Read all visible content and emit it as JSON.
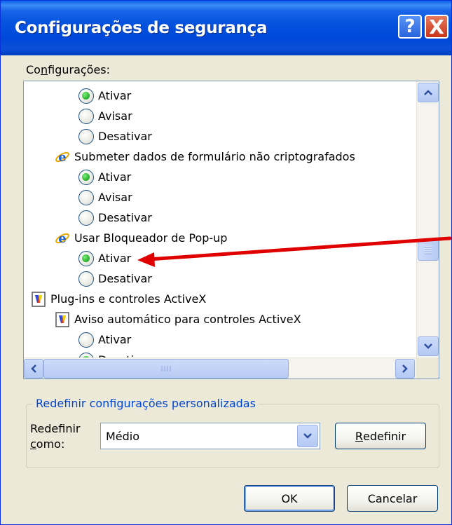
{
  "window": {
    "title": "Configurações de segurança",
    "help_symbol": "?",
    "close_symbol": "X"
  },
  "settings_label_pre": "Co",
  "settings_label_accel": "n",
  "settings_label_post": "figurações:",
  "settings_list": [
    {
      "kind": "radio",
      "label": "Ativar",
      "selected": true
    },
    {
      "kind": "radio",
      "label": "Avisar",
      "selected": false
    },
    {
      "kind": "radio",
      "label": "Desativar",
      "selected": false
    },
    {
      "kind": "ie-setting",
      "label": "Submeter dados de formulário não criptografados"
    },
    {
      "kind": "radio",
      "label": "Ativar",
      "selected": true
    },
    {
      "kind": "radio",
      "label": "Avisar",
      "selected": false
    },
    {
      "kind": "radio",
      "label": "Desativar",
      "selected": false
    },
    {
      "kind": "ie-setting",
      "label": "Usar Bloqueador de Pop-up"
    },
    {
      "kind": "radio",
      "label": "Ativar",
      "selected": true
    },
    {
      "kind": "radio",
      "label": "Desativar",
      "selected": false
    },
    {
      "kind": "activex-category",
      "label": "Plug-ins e controles ActiveX"
    },
    {
      "kind": "activex-setting",
      "label": "Aviso automático para controles ActiveX"
    },
    {
      "kind": "radio",
      "label": "Ativar",
      "selected": false
    },
    {
      "kind": "radio",
      "label": "Desativar",
      "selected": true
    }
  ],
  "reset_group": {
    "legend": "Redefinir configurações personalizadas",
    "label_line1": "Redefinir",
    "label_line2_accel": "c",
    "label_line2_rest": "omo:",
    "selected_level": "Médio",
    "button_accel": "R",
    "button_rest": "edefinir"
  },
  "buttons": {
    "ok": "OK",
    "cancel": "Cancelar"
  },
  "colors": {
    "titlebar": "#0054e3",
    "annotation_arrow": "#e00000",
    "radio_selected": "#2fb52f",
    "group_legend": "#0046d5"
  }
}
